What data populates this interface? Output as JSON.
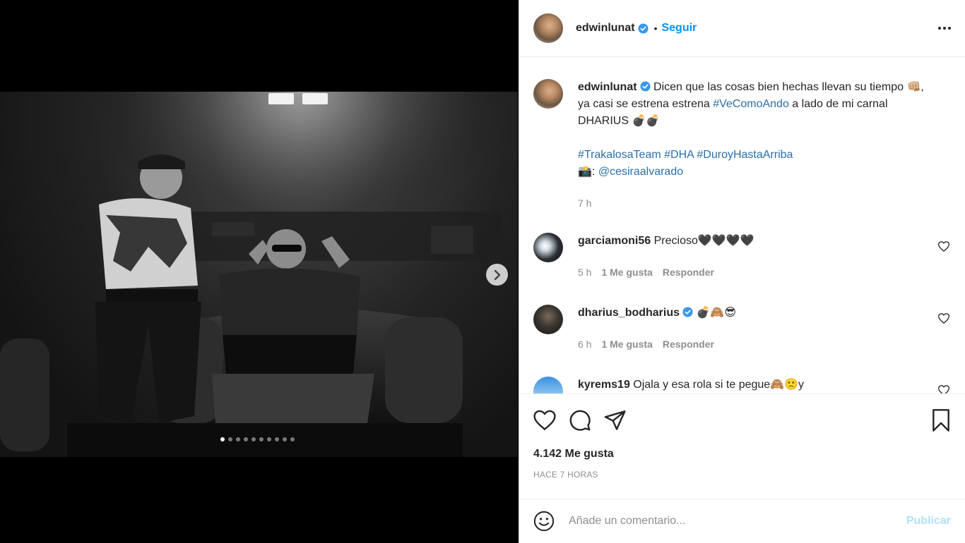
{
  "post": {
    "author": "edwinlunat",
    "separator": "•",
    "follow_label": "Seguir",
    "carousel": {
      "total_slides": 10,
      "active_index": 0
    }
  },
  "caption": {
    "username": "edwinlunat",
    "line1": "Dicen que las cosas bien hechas llevan su tiempo 👊🏼,",
    "line2_pre": "ya casi se estrena estrena ",
    "line2_tag": "#VeComoAndo",
    "line2_post": " a lado de mi carnal",
    "line3": "DHARIUS 💣💣",
    "tags": [
      "#TrakalosaTeam",
      "#DHA",
      "#DuroyHastaArriba"
    ],
    "credit_prefix": "📸: ",
    "credit_mention": "@cesiraalvarado",
    "time": "7 h"
  },
  "comments": [
    {
      "username": "garciamoni56",
      "text": "Precioso🖤🖤🖤🖤",
      "verified": false,
      "time": "5 h",
      "likes": "1 Me gusta",
      "reply": "Responder"
    },
    {
      "username": "dharius_bodharius",
      "text": "💣🙈😎",
      "verified": true,
      "time": "6 h",
      "likes": "1 Me gusta",
      "reply": "Responder"
    },
    {
      "username": "kyrems19",
      "text": "Ojala y esa rola si te pegue🙈🙁y",
      "verified": false
    }
  ],
  "actions": {
    "likes_count": "4.142 Me gusta",
    "time_ago": "HACE 7 HORAS"
  },
  "composer": {
    "placeholder": "Añade un comentario...",
    "publish_label": "Publicar"
  },
  "icons": {
    "like": "heart-icon",
    "comment": "comment-icon",
    "share": "share-icon",
    "save": "bookmark-icon",
    "emoji": "emoji-icon",
    "next": "chevron-right-icon",
    "more": "more-options-icon",
    "verified": "verified-badge-icon"
  },
  "colors": {
    "link": "#0095f6",
    "hashtag": "#00376b",
    "muted": "#8e8e8e",
    "publish_disabled": "#b2dffc"
  }
}
